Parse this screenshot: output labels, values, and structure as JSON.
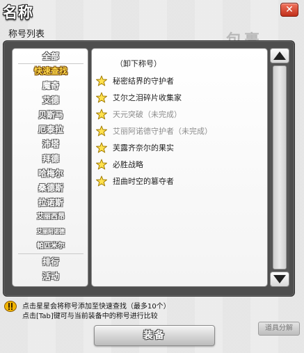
{
  "window": {
    "title": "名称",
    "close_label": "✕",
    "subtitle": "称号列表"
  },
  "background": {
    "watermark_text": "包裹",
    "side_button": "道具分解"
  },
  "categories": [
    {
      "label": "全部"
    },
    {
      "label": "快速查找",
      "active": true
    },
    {
      "label": "魔奇"
    },
    {
      "label": "艾德"
    },
    {
      "label": "贝斯马"
    },
    {
      "label": "厄泰拉"
    },
    {
      "label": "沛塔"
    },
    {
      "label": "拜德"
    },
    {
      "label": "哈梅尔"
    },
    {
      "label": "桑德斯"
    },
    {
      "label": "拉诺斯"
    },
    {
      "label": "艾丽西昂"
    },
    {
      "label": "艾丽阿诺德"
    },
    {
      "label": "帕匹米尔"
    },
    {
      "label": "排行"
    },
    {
      "label": "活动"
    }
  ],
  "title_list": {
    "unequip_label": "（卸下称号）",
    "items": [
      {
        "label": "秘密结界的守护者",
        "complete": true
      },
      {
        "label": "艾尔之泪碎片收集家",
        "complete": true
      },
      {
        "label": "天元突破（未完成）",
        "complete": false
      },
      {
        "label": "艾丽阿诺德守护者（未完成）",
        "complete": false
      },
      {
        "label": "芙露齐奈尔的果实",
        "complete": true
      },
      {
        "label": "必胜战略",
        "complete": true
      },
      {
        "label": "扭曲时空的篡夺者",
        "complete": true
      }
    ]
  },
  "notes": {
    "line1": "点击星星会将称号添加至快速查找（最多10个）",
    "line2": "点击[Tab]键可与当前装备中的称号进行比较"
  },
  "equip_button": "装备",
  "colors": {
    "panel": "#4e4e4e",
    "active_category": "#ffd84a",
    "close_button": "#c0301b",
    "incomplete_text": "#8c8c8c"
  }
}
